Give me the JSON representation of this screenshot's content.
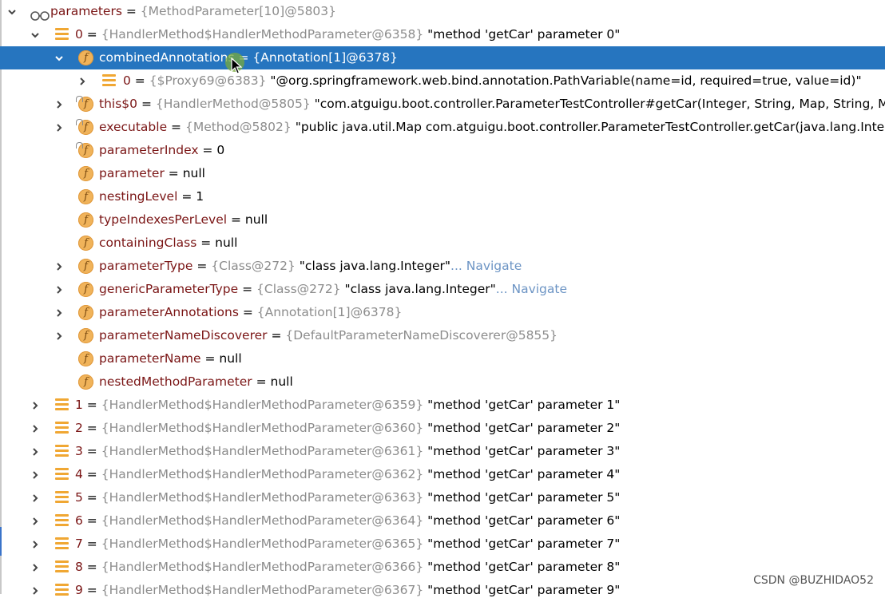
{
  "rows": [
    {
      "depth": 0,
      "toggle": "expanded",
      "icon": "glasses",
      "name": "parameters",
      "eq": " = ",
      "type": "{MethodParameter[10]@5803}",
      "val": "",
      "nav": ""
    },
    {
      "depth": 1,
      "toggle": "expanded",
      "icon": "list",
      "name": "0",
      "eq": " = ",
      "type": "{HandlerMethod$HandlerMethodParameter@6358}",
      "val": " \"method 'getCar' parameter 0\"",
      "nav": ""
    },
    {
      "depth": 2,
      "toggle": "expanded",
      "icon": "f",
      "lock": false,
      "selected": true,
      "name": "combinedAnnotations",
      "eq": " = ",
      "type": "{Annotation[1]@6378}",
      "val": "",
      "nav": ""
    },
    {
      "depth": 3,
      "toggle": "collapsed",
      "icon": "list",
      "name": "0",
      "eq": " = ",
      "type": "{$Proxy69@6383}",
      "val": " \"@org.springframework.web.bind.annotation.PathVariable(name=id, required=true, value=id)\"",
      "nav": ""
    },
    {
      "depth": 2,
      "toggle": "collapsed",
      "icon": "f",
      "lock": true,
      "name": "this$0",
      "eq": " = ",
      "type": "{HandlerMethod@5805}",
      "val": " \"com.atguigu.boot.controller.ParameterTestController#getCar(Integer, String, Map, String, Map,",
      "nav": ""
    },
    {
      "depth": 2,
      "toggle": "collapsed",
      "icon": "f",
      "lock": true,
      "name": "executable",
      "eq": " = ",
      "type": "{Method@5802}",
      "val": " \"public java.util.Map com.atguigu.boot.controller.ParameterTestController.getCar(java.lang.Integer,",
      "nav": ""
    },
    {
      "depth": 2,
      "toggle": "none",
      "icon": "f",
      "lock": true,
      "name": "parameterIndex",
      "eq": " = ",
      "type": "",
      "val": "0",
      "nav": ""
    },
    {
      "depth": 2,
      "toggle": "none",
      "icon": "f",
      "lock": false,
      "name": "parameter",
      "eq": " = ",
      "type": "",
      "val": "null",
      "nav": ""
    },
    {
      "depth": 2,
      "toggle": "none",
      "icon": "f",
      "lock": false,
      "name": "nestingLevel",
      "eq": " = ",
      "type": "",
      "val": "1",
      "nav": ""
    },
    {
      "depth": 2,
      "toggle": "none",
      "icon": "f",
      "lock": false,
      "name": "typeIndexesPerLevel",
      "eq": " = ",
      "type": "",
      "val": "null",
      "nav": ""
    },
    {
      "depth": 2,
      "toggle": "none",
      "icon": "f",
      "lock": false,
      "name": "containingClass",
      "eq": " = ",
      "type": "",
      "val": "null",
      "nav": ""
    },
    {
      "depth": 2,
      "toggle": "collapsed",
      "icon": "f",
      "lock": false,
      "name": "parameterType",
      "eq": " = ",
      "type": "{Class@272}",
      "val": " \"class java.lang.Integer\"",
      "nav": "... Navigate"
    },
    {
      "depth": 2,
      "toggle": "collapsed",
      "icon": "f",
      "lock": false,
      "name": "genericParameterType",
      "eq": " = ",
      "type": "{Class@272}",
      "val": " \"class java.lang.Integer\"",
      "nav": "... Navigate"
    },
    {
      "depth": 2,
      "toggle": "collapsed",
      "icon": "f",
      "lock": false,
      "name": "parameterAnnotations",
      "eq": " = ",
      "type": "{Annotation[1]@6378}",
      "val": "",
      "nav": ""
    },
    {
      "depth": 2,
      "toggle": "collapsed",
      "icon": "f",
      "lock": false,
      "name": "parameterNameDiscoverer",
      "eq": " = ",
      "type": "{DefaultParameterNameDiscoverer@5855}",
      "val": "",
      "nav": ""
    },
    {
      "depth": 2,
      "toggle": "none",
      "icon": "f",
      "lock": false,
      "name": "parameterName",
      "eq": " = ",
      "type": "",
      "val": "null",
      "nav": ""
    },
    {
      "depth": 2,
      "toggle": "none",
      "icon": "f",
      "lock": false,
      "name": "nestedMethodParameter",
      "eq": " = ",
      "type": "",
      "val": "null",
      "nav": ""
    },
    {
      "depth": 1,
      "toggle": "collapsed",
      "icon": "list",
      "name": "1",
      "eq": " = ",
      "type": "{HandlerMethod$HandlerMethodParameter@6359}",
      "val": " \"method 'getCar' parameter 1\"",
      "nav": ""
    },
    {
      "depth": 1,
      "toggle": "collapsed",
      "icon": "list",
      "name": "2",
      "eq": " = ",
      "type": "{HandlerMethod$HandlerMethodParameter@6360}",
      "val": " \"method 'getCar' parameter 2\"",
      "nav": ""
    },
    {
      "depth": 1,
      "toggle": "collapsed",
      "icon": "list",
      "name": "3",
      "eq": " = ",
      "type": "{HandlerMethod$HandlerMethodParameter@6361}",
      "val": " \"method 'getCar' parameter 3\"",
      "nav": ""
    },
    {
      "depth": 1,
      "toggle": "collapsed",
      "icon": "list",
      "name": "4",
      "eq": " = ",
      "type": "{HandlerMethod$HandlerMethodParameter@6362}",
      "val": " \"method 'getCar' parameter 4\"",
      "nav": ""
    },
    {
      "depth": 1,
      "toggle": "collapsed",
      "icon": "list",
      "name": "5",
      "eq": " = ",
      "type": "{HandlerMethod$HandlerMethodParameter@6363}",
      "val": " \"method 'getCar' parameter 5\"",
      "nav": ""
    },
    {
      "depth": 1,
      "toggle": "collapsed",
      "icon": "list",
      "name": "6",
      "eq": " = ",
      "type": "{HandlerMethod$HandlerMethodParameter@6364}",
      "val": " \"method 'getCar' parameter 6\"",
      "nav": ""
    },
    {
      "depth": 1,
      "toggle": "collapsed",
      "icon": "list",
      "name": "7",
      "eq": " = ",
      "type": "{HandlerMethod$HandlerMethodParameter@6365}",
      "val": " \"method 'getCar' parameter 7\"",
      "nav": ""
    },
    {
      "depth": 1,
      "toggle": "collapsed",
      "icon": "list",
      "name": "8",
      "eq": " = ",
      "type": "{HandlerMethod$HandlerMethodParameter@6366}",
      "val": " \"method 'getCar' parameter 8\"",
      "nav": ""
    },
    {
      "depth": 1,
      "toggle": "collapsed",
      "icon": "list",
      "name": "9",
      "eq": " = ",
      "type": "{HandlerMethod$HandlerMethodParameter@6367}",
      "val": " \"method 'getCar' parameter 9\"",
      "nav": ""
    }
  ],
  "watermark": "CSDN @BUZHIDAO52",
  "colors": {
    "selection": "#2675bf",
    "field_name": "#7a1515",
    "type": "#8c8c8c",
    "navigate": "#6c94c4",
    "field_icon": "#f0b35a",
    "list_icon": "#f0a733"
  }
}
